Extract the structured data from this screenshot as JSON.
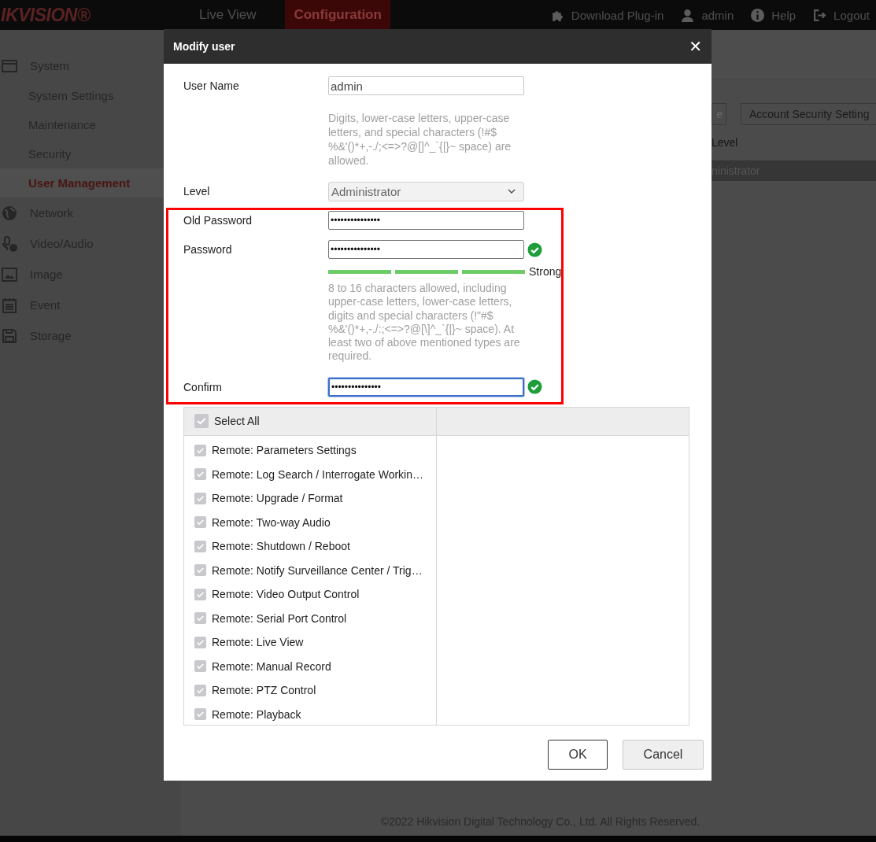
{
  "top_bar": {
    "logo": "IKVISION®",
    "nav": [
      {
        "label": "Live View",
        "selected": false
      },
      {
        "label": "Configuration",
        "selected": true
      }
    ],
    "actions": [
      {
        "label": "Download Plug-in"
      },
      {
        "label": "admin"
      },
      {
        "label": "Help"
      },
      {
        "label": "Logout"
      }
    ]
  },
  "sidebar": {
    "items": [
      {
        "label": "System",
        "children": [
          {
            "label": "System Settings",
            "selected": false
          },
          {
            "label": "Maintenance",
            "selected": false
          },
          {
            "label": "Security",
            "selected": false
          },
          {
            "label": "User Management",
            "selected": true
          }
        ]
      },
      {
        "label": "Network"
      },
      {
        "label": "Video/Audio"
      },
      {
        "label": "Image"
      },
      {
        "label": "Event"
      },
      {
        "label": "Storage"
      }
    ]
  },
  "background": {
    "buttons": [
      "e",
      "Account Security Setting"
    ],
    "table": {
      "columns": [
        "Level"
      ],
      "rows": [
        [
          "ninistrator"
        ]
      ]
    }
  },
  "dialog": {
    "title": "Modify user",
    "close": "✕",
    "user_name": {
      "label": "User Name",
      "value": "admin",
      "hint": "Digits, lower-case letters, upper-case letters, and special characters (!#$ %&'()*+,-./;<=>?@[]^_`{|}~ space) are allowed."
    },
    "level": {
      "label": "Level",
      "value": "Administrator"
    },
    "old_password": {
      "label": "Old Password",
      "value": "•••••••••••••••"
    },
    "password": {
      "label": "Password",
      "value": "•••••••••••••••",
      "valid": true,
      "strength": {
        "level": 1,
        "label": "Strong"
      },
      "hint": "8 to 16 characters allowed, including upper-case letters, lower-case letters, digits and special characters (!\"#$ %&'()*+,-./:;<=>?@[\\]^_`{|}~ space). At least two of above mentioned types are required."
    },
    "confirm": {
      "label": "Confirm",
      "value": "•••••••••••••••",
      "valid": true,
      "focused": true
    },
    "highlight": true,
    "permissions": {
      "select_all": {
        "label": "Select All",
        "checked": true
      },
      "disabled": true,
      "items": [
        {
          "label": "Remote: Parameters Settings",
          "checked": true
        },
        {
          "label": "Remote: Log Search / Interrogate Workin…",
          "checked": true
        },
        {
          "label": "Remote: Upgrade / Format",
          "checked": true
        },
        {
          "label": "Remote: Two-way Audio",
          "checked": true
        },
        {
          "label": "Remote: Shutdown / Reboot",
          "checked": true
        },
        {
          "label": "Remote: Notify Surveillance Center / Trig…",
          "checked": true
        },
        {
          "label": "Remote: Video Output Control",
          "checked": true
        },
        {
          "label": "Remote: Serial Port Control",
          "checked": true
        },
        {
          "label": "Remote: Live View",
          "checked": true
        },
        {
          "label": "Remote: Manual Record",
          "checked": true
        },
        {
          "label": "Remote: PTZ Control",
          "checked": true
        },
        {
          "label": "Remote: Playback",
          "checked": true
        }
      ]
    },
    "buttons": [
      {
        "label": "OK",
        "kind": "primary"
      },
      {
        "label": "Cancel",
        "kind": "secondary"
      }
    ]
  },
  "footer": "©2022 Hikvision Digital Technology Co., Ltd. All Rights Reserved."
}
